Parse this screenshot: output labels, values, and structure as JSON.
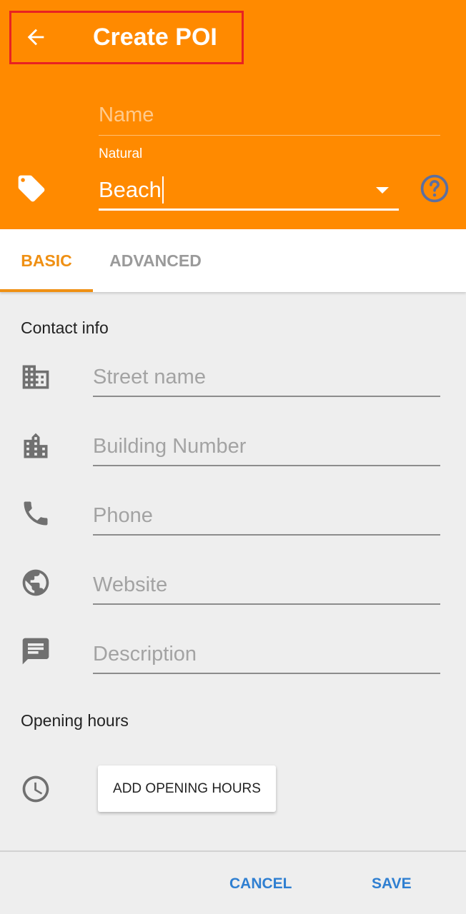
{
  "header": {
    "title": "Create POI",
    "back_icon": "arrow-left-icon",
    "name_placeholder": "Name",
    "category_label": "Natural",
    "category_value": "Beach",
    "tag_icon": "tag-icon",
    "help_icon": "help-circle-icon",
    "background": "#ff8a00",
    "highlight_color": "#e82222"
  },
  "tabs": [
    {
      "label": "BASIC",
      "active": true
    },
    {
      "label": "ADVANCED",
      "active": false
    }
  ],
  "contact": {
    "title": "Contact info",
    "fields": [
      {
        "icon": "city-icon",
        "placeholder": "Street name"
      },
      {
        "icon": "building-icon",
        "placeholder": "Building Number"
      },
      {
        "icon": "phone-icon",
        "placeholder": "Phone"
      },
      {
        "icon": "globe-icon",
        "placeholder": "Website"
      },
      {
        "icon": "comment-icon",
        "placeholder": "Description"
      }
    ]
  },
  "opening_hours": {
    "title": "Opening hours",
    "icon": "clock-icon",
    "button_label": "ADD OPENING HOURS"
  },
  "footer": {
    "cancel_label": "CANCEL",
    "save_label": "SAVE",
    "accent": "#2f7fd1"
  },
  "colors": {
    "tab_accent": "#ef9014",
    "icon_gray": "#707070"
  }
}
